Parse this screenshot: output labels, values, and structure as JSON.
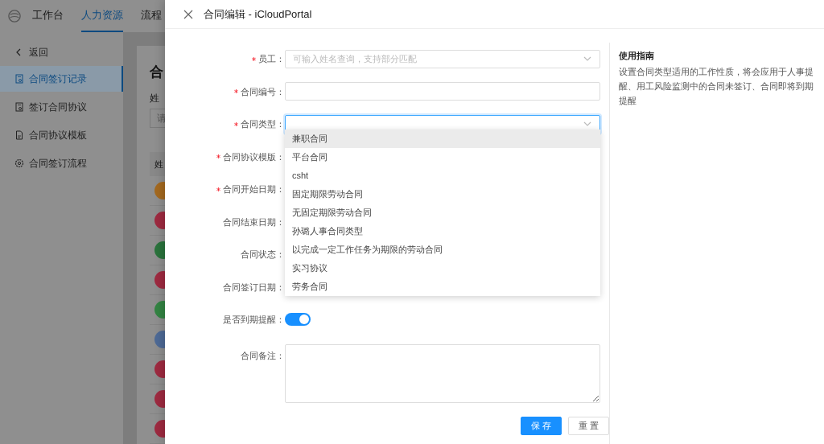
{
  "background": {
    "nav_tabs": [
      {
        "label": "工作台",
        "selected": false
      },
      {
        "label": "人力资源",
        "selected": true
      },
      {
        "label": "流程",
        "selected": false
      }
    ],
    "sidebar": {
      "back": "返回",
      "items": [
        {
          "label": "合同签订记录",
          "kind": "record",
          "selected": true
        },
        {
          "label": "签订合同协议",
          "kind": "record",
          "selected": false
        },
        {
          "label": "合同协议模板",
          "kind": "template",
          "selected": false
        },
        {
          "label": "合同签订流程",
          "kind": "process",
          "selected": false
        }
      ]
    },
    "page_title": "合",
    "filter_label": "姓",
    "filter_placeholder": "请",
    "table_header": "姓",
    "avatars": [
      {
        "color": "#a4691f"
      },
      {
        "color": "#9e2a40"
      },
      {
        "color": "#2a733c"
      },
      {
        "color": "#9e2a40"
      },
      {
        "color": "#338443"
      },
      {
        "color": "#4e6a96"
      },
      {
        "color": "#9e2a40"
      },
      {
        "color": "#9e2a40"
      },
      {
        "color": "#9e2a40"
      }
    ]
  },
  "drawer": {
    "title": "合同编辑 - iCloudPortal",
    "fields": [
      {
        "label": "员工：",
        "required": true,
        "kind": "select",
        "placeholder": "可输入姓名查询，支持部分匹配",
        "focused": false
      },
      {
        "label": "合同编号：",
        "required": true,
        "kind": "input",
        "focused": false
      },
      {
        "label": "合同类型：",
        "required": true,
        "kind": "select",
        "focused": true
      },
      {
        "label": "合同协议模版：",
        "required": true,
        "kind": "covered"
      },
      {
        "label": "合同开始日期：",
        "required": true,
        "kind": "covered"
      },
      {
        "label": "合同结束日期：",
        "required": false,
        "kind": "covered"
      },
      {
        "label": "合同状态：",
        "required": false,
        "kind": "covered"
      },
      {
        "label": "合同签订日期：",
        "required": false,
        "kind": "covered"
      },
      {
        "label": "是否到期提醒：",
        "required": false,
        "kind": "switch",
        "on": true
      },
      {
        "label": "合同备注：",
        "required": false,
        "kind": "textarea"
      }
    ],
    "dropdown": [
      {
        "label": "兼职合同",
        "highlighted": true
      },
      {
        "label": "平台合同",
        "highlighted": false
      },
      {
        "label": "csht",
        "highlighted": false
      },
      {
        "label": "固定期限劳动合同",
        "highlighted": false
      },
      {
        "label": "无固定期限劳动合同",
        "highlighted": false
      },
      {
        "label": "孙璐人事合同类型",
        "highlighted": false
      },
      {
        "label": "以完成一定工作任务为期限的劳动合同",
        "highlighted": false
      },
      {
        "label": "实习协议",
        "highlighted": false
      },
      {
        "label": "劳务合同",
        "highlighted": false
      }
    ],
    "buttons": [
      {
        "label": "保 存",
        "kind": "primary"
      },
      {
        "label": "重 置",
        "kind": "default"
      }
    ],
    "guide": {
      "title": "使用指南",
      "text": "设置合同类型适用的工作性质，将会应用于人事提醒、用工风险监测中的合同未签订、合同即将到期提醒"
    }
  }
}
